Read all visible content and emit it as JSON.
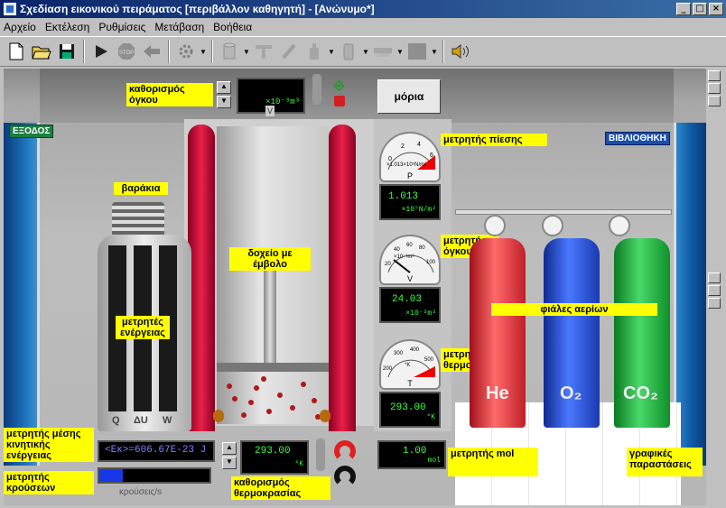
{
  "window": {
    "title": "Σχεδίαση εικονικού πειράματος [περιβάλλον καθηγητή] - [Ανώνυμο*]",
    "btn_min": "_",
    "btn_max": "□",
    "btn_close": "×"
  },
  "menu": [
    "Αρχείο",
    "Εκτέλεση",
    "Ρυθμίσεις",
    "Μετάβαση",
    "Βοήθεια"
  ],
  "toolbar": {
    "icons": [
      "new-file-icon",
      "open-folder-icon",
      "save-icon",
      "play-icon",
      "stop-icon",
      "back-arrow-icon",
      "gear-icon",
      "cylinder-icon",
      "piston-icon",
      "thermometer-icon",
      "bottle-icon",
      "container-icon",
      "plate-icon",
      "color-box-icon",
      "speaker-icon"
    ]
  },
  "signs": {
    "exit": "ΕΞΟΔΟΣ",
    "library": "ΒΙΒΛΙΟΘΗΚΗ"
  },
  "labels": {
    "volume_setting": "καθορισμός όγκου",
    "weights": "βαράκια",
    "container": "δοχείο με έμβολο",
    "energy_meters": "μετρητές ενέργειας",
    "pressure_meter": "μετρητής πίεσης",
    "volume_meter": "μετρητής όγκου",
    "temperature_meter": "μετρητής θερμοκρασίας",
    "gas_bottles": "φιάλες αερίων",
    "mean_ke_meter": "μετρητής μέσης κινητικής ενέργειας",
    "collision_meter": "μετρητής κρούσεων",
    "temperature_setting": "καθορισμός θερμοκρασίας",
    "mol_meter": "μετρητής mol",
    "graphs": "γραφικές παραστάσεις"
  },
  "particles_button": "μόρια",
  "volume_setting_unit": "×10⁻³m³",
  "volume_setting_v": "V",
  "energy_bars": [
    "Q",
    "ΔU",
    "W"
  ],
  "pressure": {
    "symbol": "P",
    "value": "1.013",
    "unit": "×10⁵N/m²",
    "scale": [
      "0",
      "2",
      "4",
      "6"
    ],
    "scale_text": "×1.013×10⁵N/m²"
  },
  "volume": {
    "symbol": "V",
    "value": "24.03",
    "unit": "×10⁻³m³",
    "scale": [
      "20",
      "40",
      "60",
      "80",
      "100"
    ],
    "scale_text": "×10⁻³m³"
  },
  "temperature": {
    "symbol": "T",
    "value": "293.00",
    "unit": "°K",
    "scale": [
      "200",
      "300",
      "400",
      "500"
    ],
    "scale_text": "°K"
  },
  "mean_ke": "<Εκ>=606.67E-23 J",
  "collisions_text": "κρούσεις/s",
  "temp_setting": {
    "value": "293.00",
    "unit": "°K"
  },
  "mol": {
    "value": "1.00",
    "unit": "mol"
  },
  "gases": [
    "He",
    "O₂",
    "CO₂"
  ],
  "colors": {
    "accent_yellow": "#ffff00",
    "lcd_green": "#3cff3c",
    "piston_red": "#d0103a"
  }
}
